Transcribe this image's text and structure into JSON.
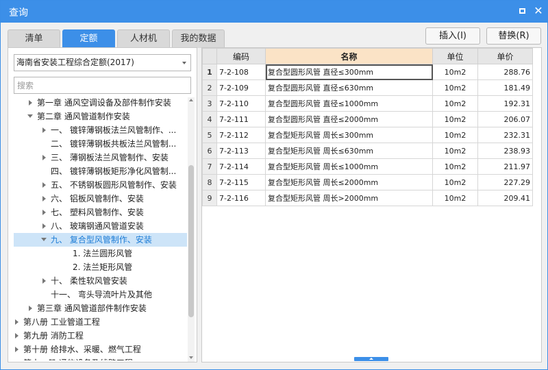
{
  "window": {
    "title": "查询"
  },
  "tabs": [
    {
      "label": "清单"
    },
    {
      "label": "定额"
    },
    {
      "label": "人材机"
    },
    {
      "label": "我的数据"
    }
  ],
  "buttons": {
    "insert": "插入(I)",
    "replace": "替换(R)"
  },
  "left": {
    "select_value": "海南省安装工程综合定额(2017)",
    "search_placeholder": "搜索",
    "tree": [
      {
        "label": "第一章 通风空调设备及部件制作安装",
        "twisty": "collapsed",
        "level": 1
      },
      {
        "label": "第二章 通风管道制作安装",
        "twisty": "expanded",
        "level": 1
      },
      {
        "label": "一、 镀锌薄钢板法兰风管制作、...",
        "twisty": "collapsed",
        "level": 2
      },
      {
        "label": "二、 镀锌薄钢板共板法兰风管制...",
        "twisty": "none",
        "level": 2
      },
      {
        "label": "三、 薄钢板法兰风管制作、安装",
        "twisty": "collapsed",
        "level": 2
      },
      {
        "label": "四、 镀锌薄钢板矩形净化风管制...",
        "twisty": "none",
        "level": 2
      },
      {
        "label": "五、 不锈钢板圆形风管制作、安装",
        "twisty": "collapsed",
        "level": 2
      },
      {
        "label": "六、 铝板风管制作、安装",
        "twisty": "collapsed",
        "level": 2
      },
      {
        "label": "七、 塑料风管制作、安装",
        "twisty": "collapsed",
        "level": 2
      },
      {
        "label": "八、 玻璃钢通风管道安装",
        "twisty": "collapsed",
        "level": 2
      },
      {
        "label": "九、 复合型风管制作、安装",
        "twisty": "expanded",
        "level": 2,
        "selected": true
      },
      {
        "label": "1. 法兰圆形风管",
        "twisty": "none",
        "level": 3
      },
      {
        "label": "2. 法兰矩形风管",
        "twisty": "none",
        "level": 3
      },
      {
        "label": "十、 柔性软风管安装",
        "twisty": "collapsed",
        "level": 2
      },
      {
        "label": "十一、 弯头导流叶片及其他",
        "twisty": "none",
        "level": 2
      },
      {
        "label": "第三章 通风管道部件制作安装",
        "twisty": "collapsed",
        "level": 1
      },
      {
        "label": "第八册 工业管道工程",
        "twisty": "collapsed",
        "level": 0
      },
      {
        "label": "第九册 消防工程",
        "twisty": "collapsed",
        "level": 0
      },
      {
        "label": "第十册 给排水、采暖、燃气工程",
        "twisty": "collapsed",
        "level": 0
      },
      {
        "label": "第十一册 通信设备及线路工程",
        "twisty": "collapsed",
        "level": 0
      }
    ]
  },
  "grid": {
    "headers": {
      "code": "编码",
      "name": "名称",
      "unit": "单位",
      "price": "单价"
    },
    "rows": [
      {
        "num": "1",
        "code": "7-2-108",
        "name": "复合型圆形风管 直径≤300mm",
        "unit": "10m2",
        "price": "288.76"
      },
      {
        "num": "2",
        "code": "7-2-109",
        "name": "复合型圆形风管 直径≤630mm",
        "unit": "10m2",
        "price": "181.49"
      },
      {
        "num": "3",
        "code": "7-2-110",
        "name": "复合型圆形风管 直径≤1000mm",
        "unit": "10m2",
        "price": "192.31"
      },
      {
        "num": "4",
        "code": "7-2-111",
        "name": "复合型圆形风管 直径≤2000mm",
        "unit": "10m2",
        "price": "206.07"
      },
      {
        "num": "5",
        "code": "7-2-112",
        "name": "复合型矩形风管 周长≤300mm",
        "unit": "10m2",
        "price": "232.31"
      },
      {
        "num": "6",
        "code": "7-2-113",
        "name": "复合型矩形风管 周长≤630mm",
        "unit": "10m2",
        "price": "238.93"
      },
      {
        "num": "7",
        "code": "7-2-114",
        "name": "复合型矩形风管 周长≤1000mm",
        "unit": "10m2",
        "price": "211.97"
      },
      {
        "num": "8",
        "code": "7-2-115",
        "name": "复合型矩形风管 周长≤2000mm",
        "unit": "10m2",
        "price": "227.29"
      },
      {
        "num": "9",
        "code": "7-2-116",
        "name": "复合型矩形风管 周长>2000mm",
        "unit": "10m2",
        "price": "209.41"
      }
    ]
  },
  "colors": {
    "accent": "#3c8fe8",
    "header_highlight": "#fbe3c6",
    "selected_row": "#cde4f8"
  }
}
